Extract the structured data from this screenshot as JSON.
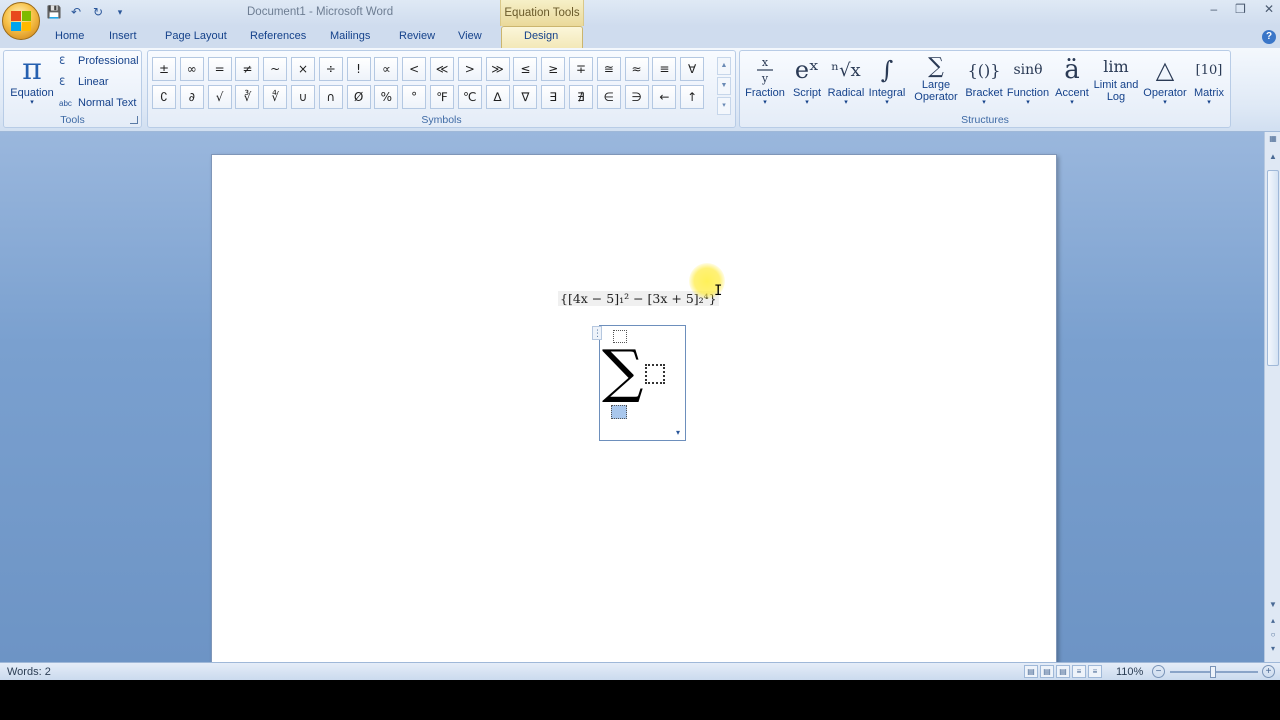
{
  "title_bar": {
    "document_title": "Document1 - Microsoft Word",
    "context_tab_title": "Equation Tools",
    "qat_icons": [
      "save-icon",
      "undo-icon",
      "redo-icon",
      "customize-qat-icon"
    ],
    "minimize": "–",
    "restore": "❒",
    "close": "✕"
  },
  "tabs": [
    "Home",
    "Insert",
    "Page Layout",
    "References",
    "Mailings",
    "Review",
    "View",
    "Design"
  ],
  "active_tab": "Design",
  "help": "?",
  "ribbon": {
    "tools": {
      "label": "Tools",
      "equation_icon": "π",
      "equation_label": "Equation",
      "items": [
        {
          "icon": "ℇ",
          "label": "Professional"
        },
        {
          "icon": "ℇ",
          "label": "Linear"
        },
        {
          "icon": "abc",
          "label": "Normal Text"
        }
      ]
    },
    "symbols": {
      "label": "Symbols",
      "items": [
        "±",
        "∞",
        "=",
        "≠",
        "~",
        "×",
        "÷",
        "!",
        "∝",
        "<",
        "≪",
        ">",
        "≫",
        "≤",
        "≥",
        "∓",
        "≅",
        "≈",
        "≡",
        "∀",
        "∁",
        "∂",
        "√",
        "∛",
        "∜",
        "∪",
        "∩",
        "Ø",
        "%",
        "°",
        "℉",
        "℃",
        "∆",
        "∇",
        "∃",
        "∄",
        "∈",
        "∋",
        "←",
        "↑"
      ],
      "scroll_up": "▲",
      "scroll_down": "▼",
      "more": "▾"
    },
    "structures": {
      "label": "Structures",
      "items": [
        {
          "label": "Fraction",
          "icon": "x/y"
        },
        {
          "label": "Script",
          "icon": "eˣ"
        },
        {
          "label": "Radical",
          "icon": "ⁿ√x"
        },
        {
          "label": "Integral",
          "icon": "∫"
        },
        {
          "label": "Large Operator",
          "icon": "∑"
        },
        {
          "label": "Bracket",
          "icon": "{()}"
        },
        {
          "label": "Function",
          "icon": "sinθ"
        },
        {
          "label": "Accent",
          "icon": "ä"
        },
        {
          "label": "Limit and Log",
          "icon": "lim"
        },
        {
          "label": "Operator",
          "icon": "△"
        },
        {
          "label": "Matrix",
          "icon": "[10]"
        }
      ]
    }
  },
  "document": {
    "equation_text": "{[4x − 5]₁² − [3x + 5]₂⁴}",
    "eq_handle": "⋮",
    "large_operator_symbol": "∑",
    "dropdown_arrow": "▾",
    "ibeam": "I"
  },
  "status_bar": {
    "words": "Words: 2",
    "zoom": "110%",
    "zoom_minus": "−",
    "zoom_plus": "+"
  },
  "colors": {
    "accent": "#15428b",
    "ribbon_bg": "#dfe9f6",
    "workspace": "#7aa0cf",
    "context_tab": "#f3e8b8",
    "cursor_highlight": "#ffeb3c"
  }
}
